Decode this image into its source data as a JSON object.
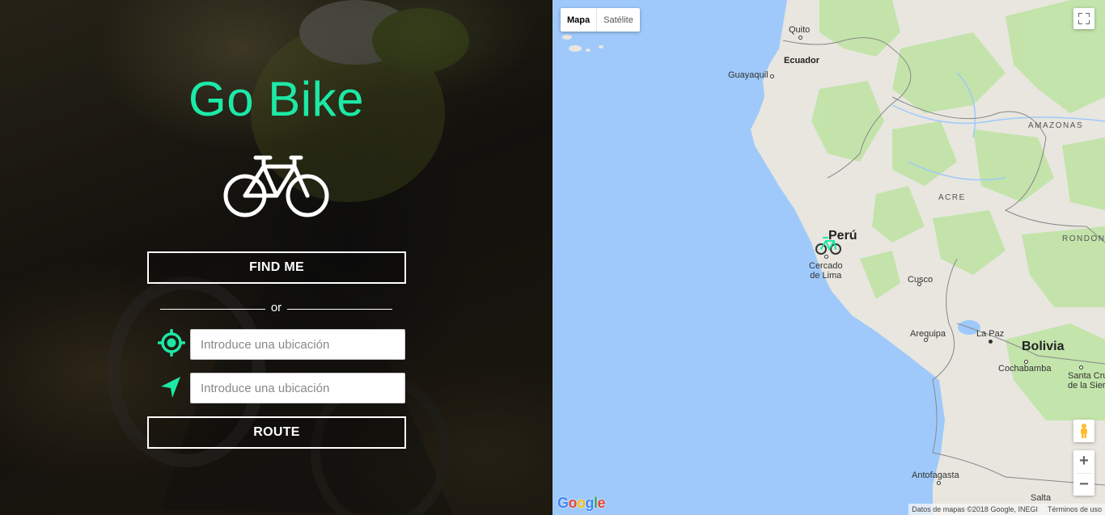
{
  "left": {
    "title": "Go Bike",
    "find_me_label": "FIND ME",
    "or_label": "or",
    "origin_placeholder": "Introduce una ubicación",
    "destination_placeholder": "Introduce una ubicación",
    "route_label": "ROUTE",
    "accent_color": "#1de9a6"
  },
  "map": {
    "map_type_tabs": [
      "Mapa",
      "Satélite"
    ],
    "active_tab": "Mapa",
    "zoom_in": "+",
    "zoom_out": "−",
    "google_logo": [
      "G",
      "o",
      "o",
      "g",
      "l",
      "e"
    ],
    "attribution": "Datos de mapas ©2018 Google, INEGI",
    "terms": "Términos de uso",
    "labels": {
      "quito": "Quito",
      "ecuador": "Ecuador",
      "guayaquil": "Guayaquil",
      "amazonas": "AMAZONAS",
      "acre": "ACRE",
      "peru": "Perú",
      "rondonia": "RONDONI",
      "lima": "Cercado\nde Lima",
      "cusco": "Cusco",
      "arequipa": "Arequipa",
      "la_paz": "La Paz",
      "bolivia": "Bolivia",
      "cochabamba": "Cochabamba",
      "santa_cruz": "Santa Cruz\nde la Sierra",
      "antofagasta": "Antofagasta",
      "salta": "Salta"
    },
    "icons": [
      "fullscreen-icon",
      "pegman-icon",
      "bike-marker-icon"
    ]
  }
}
